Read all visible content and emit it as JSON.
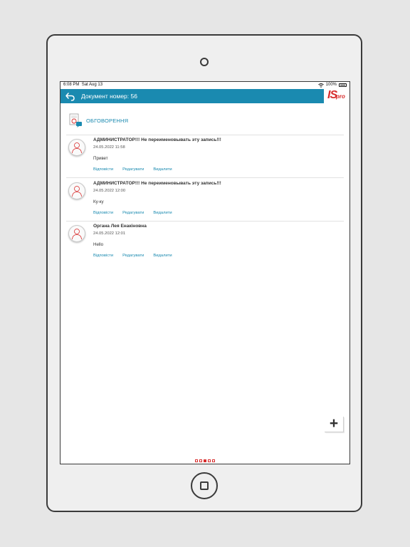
{
  "status_bar": {
    "time": "6:08 PM",
    "date": "Sat Aug 13",
    "battery": "100%"
  },
  "header": {
    "title": "Документ номер: 56",
    "logo_big": "IS",
    "logo_small": "pro"
  },
  "section": {
    "title": "ОБГОВОРЕННЯ"
  },
  "comments": [
    {
      "author": "АДМИНИСТРАТОР!!! Не переименовывать эту запись!!!",
      "date": "24.05.2022 11:58",
      "text": "Привет"
    },
    {
      "author": "АДМИНИСТРАТОР!!! Не переименовывать эту запись!!!",
      "date": "24.05.2022 12:00",
      "text": "Ку-ку"
    },
    {
      "author": "Органа Лея Енакіновна",
      "date": "24.05.2022 12:01",
      "text": "Hello"
    }
  ],
  "actions": {
    "reply": "Відповісти",
    "edit": "Редагувати",
    "delete": "Видалити"
  },
  "fab": {
    "label": "+"
  },
  "pager": {
    "total": 5,
    "active": 3
  },
  "colors": {
    "accent": "#1a8ab0",
    "brand": "#d72c2c"
  }
}
